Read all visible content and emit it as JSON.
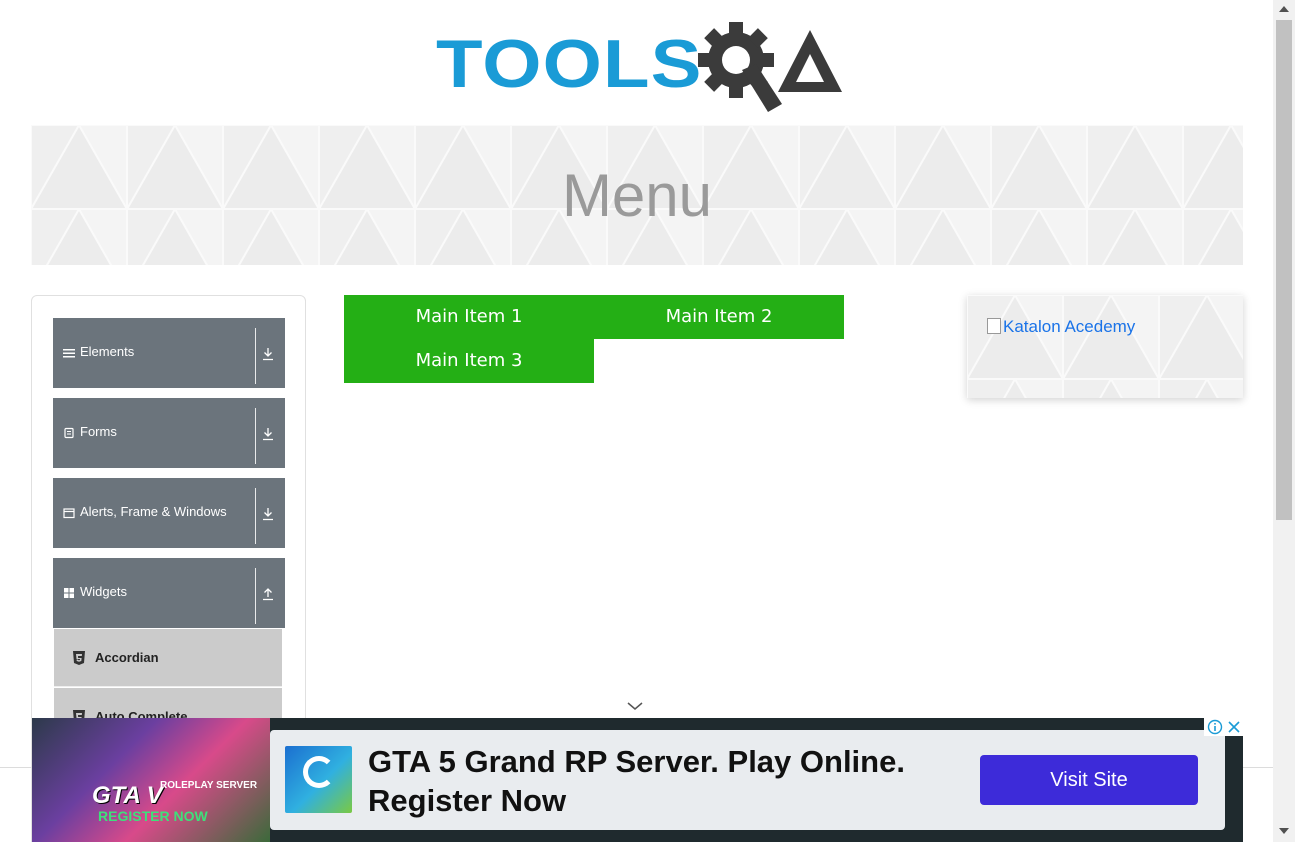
{
  "header": {
    "logo_text": "TOOLSQA",
    "logo_word": "TOOLS",
    "logo_color": "#1a9bd6"
  },
  "banner": {
    "title": "Menu"
  },
  "sidebar": {
    "groups": [
      {
        "label": "Elements",
        "icon": "hamburger-icon",
        "arrow": "download-icon",
        "expanded": false
      },
      {
        "label": "Forms",
        "icon": "form-icon",
        "arrow": "download-icon",
        "expanded": false
      },
      {
        "label": "Alerts, Frame & Windows",
        "icon": "window-icon",
        "arrow": "download-icon",
        "expanded": false
      },
      {
        "label": "Widgets",
        "icon": "grid-icon",
        "arrow": "upload-icon",
        "expanded": true
      }
    ],
    "widget_items": [
      {
        "label": "Accordian",
        "icon": "html5-icon"
      },
      {
        "label": "Auto Complete",
        "icon": "html5-icon"
      }
    ]
  },
  "menu": {
    "items": [
      "Main Item 1",
      "Main Item 2",
      "Main Item 3"
    ],
    "color": "#24af15"
  },
  "right_ad": {
    "alt_text": "Katalon Acedemy"
  },
  "bottom_ad": {
    "image_text_main": "GTA V",
    "image_text_side": "ROLEPLAY SERVER",
    "image_text_cta": "REGISTER NOW",
    "headline": "GTA 5 Grand RP Server. Play Online. Register Now",
    "button": "Visit Site",
    "button_color": "#3d2bd9"
  }
}
